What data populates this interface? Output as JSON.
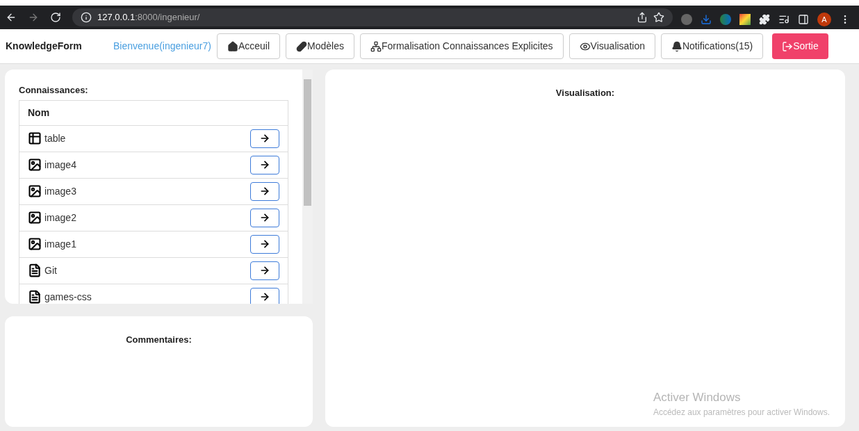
{
  "browser": {
    "url_host": "127.0.0.1",
    "url_path": ":8000/ingenieur/",
    "profile_initial": "A"
  },
  "navbar": {
    "brand": "KnowledgeForm",
    "welcome": "Bienvenue(ingenieur7)",
    "buttons": [
      {
        "label": "Acceuil",
        "kind": "home"
      },
      {
        "label": "Modèles",
        "kind": "models"
      },
      {
        "label": "Formalisation Connaissances Explicites",
        "kind": "tree"
      },
      {
        "label": "Visualisation",
        "kind": "eye"
      },
      {
        "label": "Notifications(15)",
        "kind": "bell"
      },
      {
        "label": "Sortie",
        "kind": "logout"
      }
    ]
  },
  "knowledge": {
    "title": "Connaissances:",
    "column": "Nom",
    "rows": [
      {
        "name": "table",
        "kind": "table"
      },
      {
        "name": "image4",
        "kind": "image"
      },
      {
        "name": "image3",
        "kind": "image"
      },
      {
        "name": "image2",
        "kind": "image"
      },
      {
        "name": "image1",
        "kind": "image"
      },
      {
        "name": "Git",
        "kind": "pdf"
      },
      {
        "name": "games-css",
        "kind": "pdf"
      }
    ]
  },
  "comments": {
    "title": "Commentaires:"
  },
  "visualisation": {
    "title": "Visualisation:"
  },
  "os_notice": {
    "title": "Activer Windows",
    "text": "Accédez aux paramètres pour activer Windows."
  }
}
